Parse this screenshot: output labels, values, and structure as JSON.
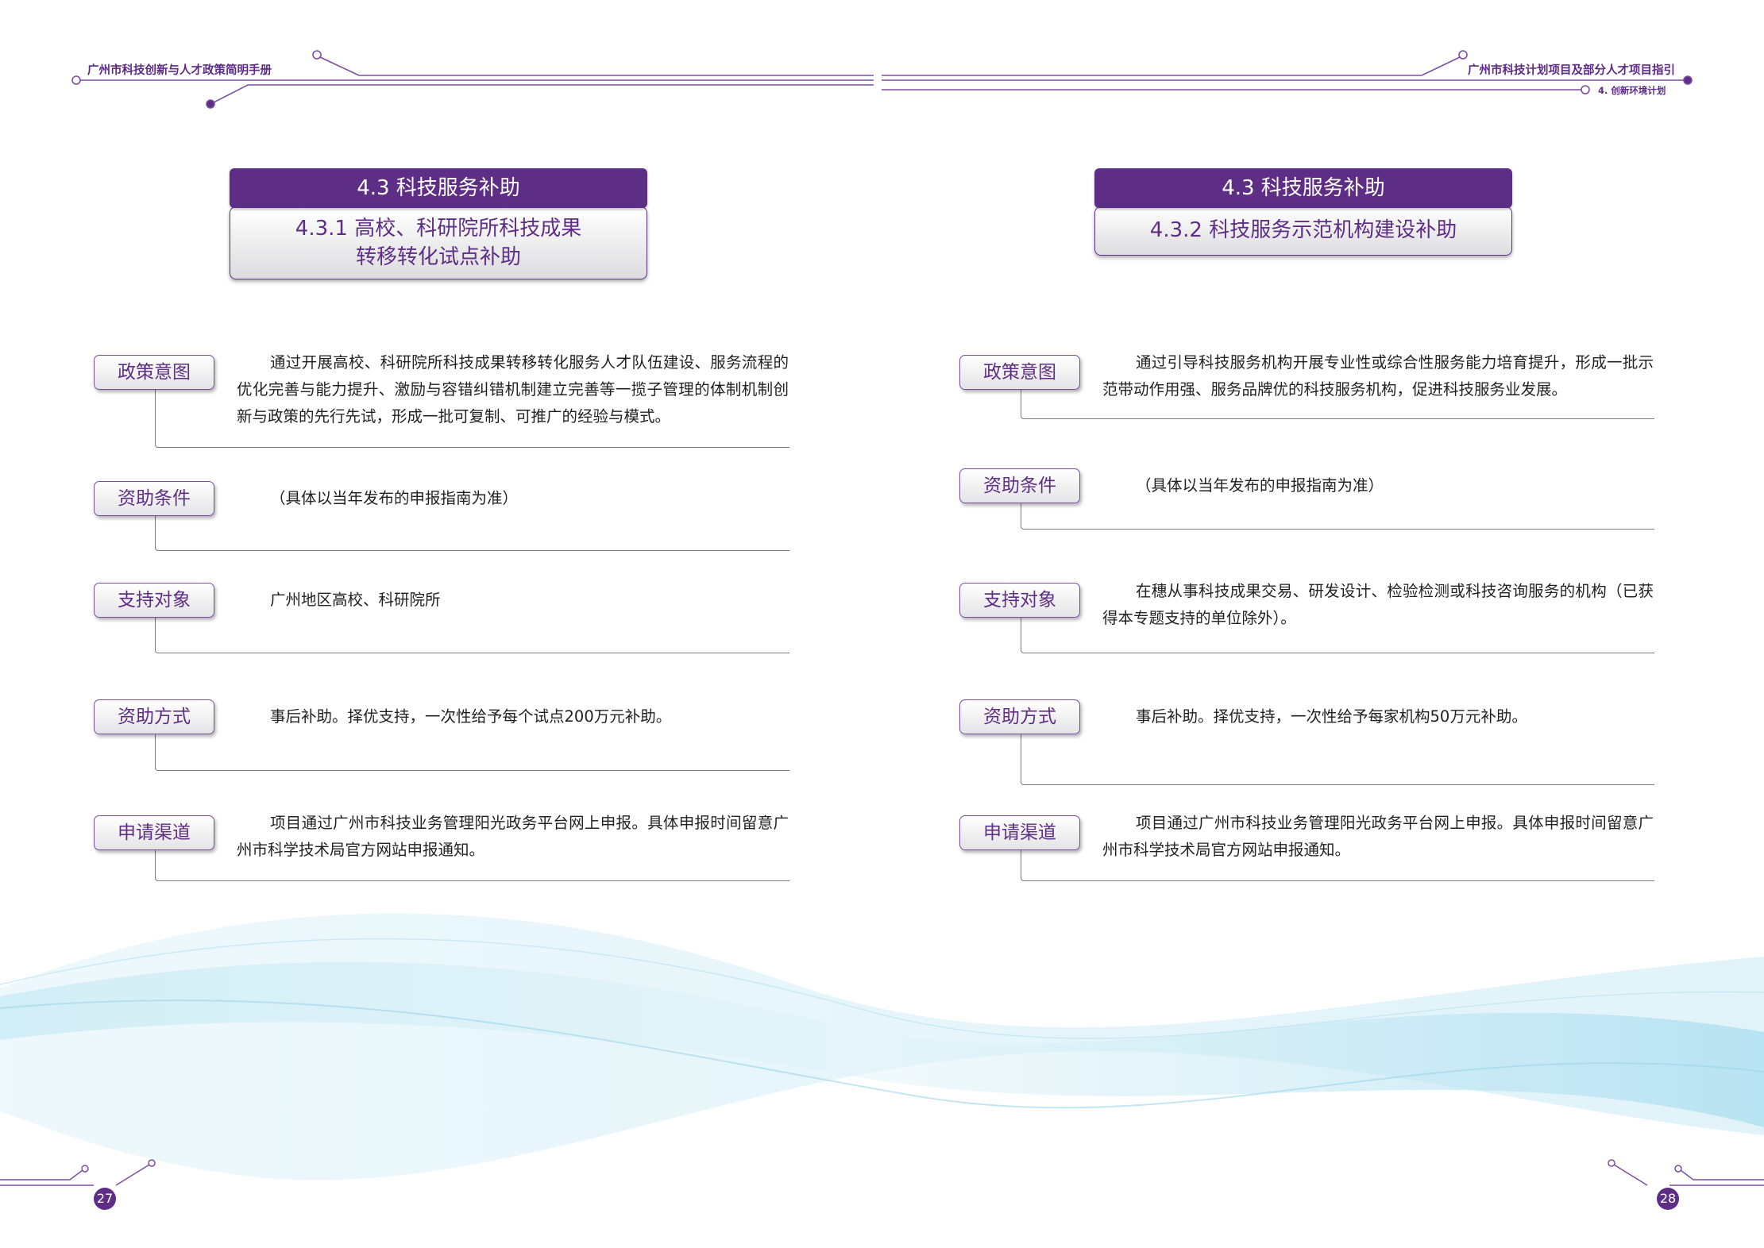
{
  "header": {
    "left_title": "广州市科技创新与人才政策简明手册",
    "right_title": "广州市科技计划项目及部分人才项目指引",
    "right_subtitle": "4. 创新环境计划"
  },
  "colors": {
    "accent": "#5e2d86",
    "line": "#7a7a7a"
  },
  "left_page": {
    "section_title": "4.3  科技服务补助",
    "subsection_line1": "4.3.1  高校、科研院所科技成果",
    "subsection_line2": "转移转化试点补助",
    "rows": [
      {
        "label": "政策意图",
        "text": "通过开展高校、科研院所科技成果转移转化服务人才队伍建设、服务流程的优化完善与能力提升、激励与容错纠错机制建立完善等一揽子管理的体制机制创新与政策的先行先试，形成一批可复制、可推广的经验与模式。"
      },
      {
        "label": "资助条件",
        "text": "（具体以当年发布的申报指南为准）"
      },
      {
        "label": "支持对象",
        "text": "广州地区高校、科研院所"
      },
      {
        "label": "资助方式",
        "text": "事后补助。择优支持，一次性给予每个试点200万元补助。"
      },
      {
        "label": "申请渠道",
        "text": "项目通过广州市科技业务管理阳光政务平台网上申报。具体申报时间留意广州市科学技术局官方网站申报通知。"
      }
    ],
    "page_number": "27"
  },
  "right_page": {
    "section_title": "4.3  科技服务补助",
    "subsection_line1": "4.3.2  科技服务示范机构建设补助",
    "rows": [
      {
        "label": "政策意图",
        "text": "通过引导科技服务机构开展专业性或综合性服务能力培育提升，形成一批示范带动作用强、服务品牌优的科技服务机构，促进科技服务业发展。"
      },
      {
        "label": "资助条件",
        "text": "（具体以当年发布的申报指南为准）"
      },
      {
        "label": "支持对象",
        "text": "在穗从事科技成果交易、研发设计、检验检测或科技咨询服务的机构（已获得本专题支持的单位除外）。"
      },
      {
        "label": "资助方式",
        "text": "事后补助。择优支持，一次性给予每家机构50万元补助。"
      },
      {
        "label": "申请渠道",
        "text": "项目通过广州市科技业务管理阳光政务平台网上申报。具体申报时间留意广州市科学技术局官方网站申报通知。"
      }
    ],
    "page_number": "28"
  }
}
